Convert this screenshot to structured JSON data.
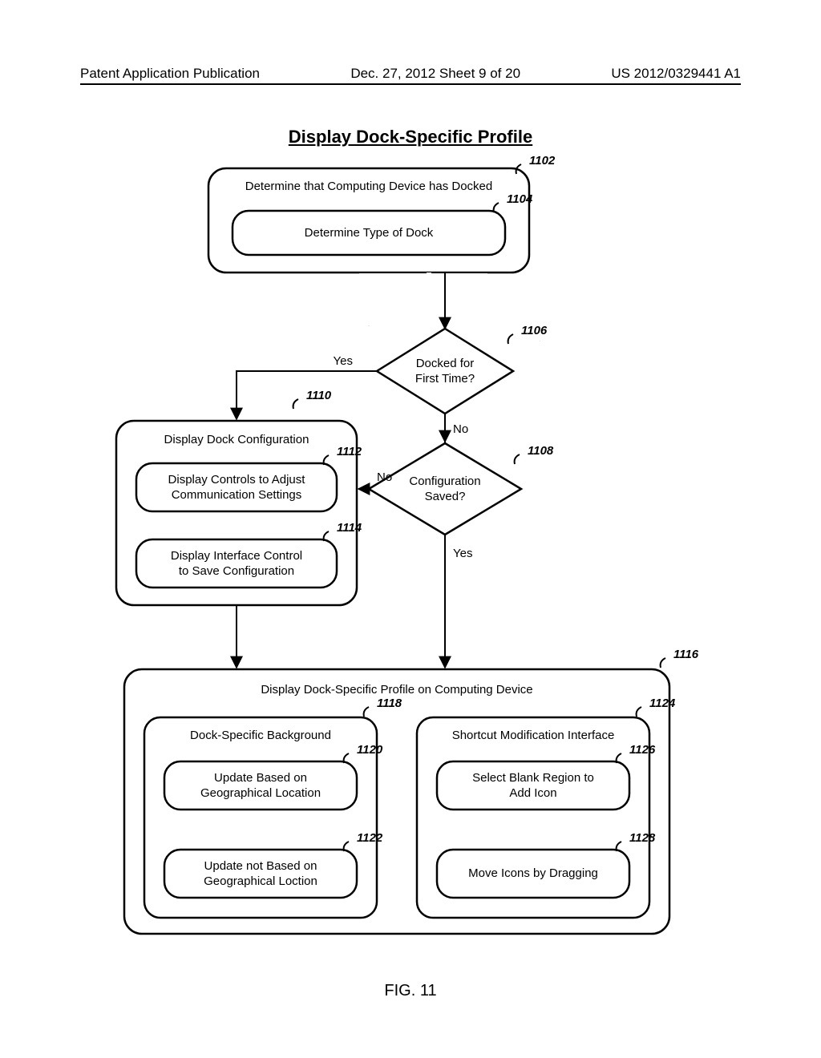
{
  "header": {
    "left": "Patent Application Publication",
    "center": "Dec. 27, 2012  Sheet 9 of 20",
    "right": "US 2012/0329441 A1"
  },
  "title": "Display Dock-Specific Profile",
  "figure_label": "FIG. 11",
  "refs": {
    "b1102": "1102",
    "b1104": "1104",
    "b1106": "1106",
    "b1108": "1108",
    "b1110": "1110",
    "b1112": "1112",
    "b1114": "1114",
    "b1116": "1116",
    "b1118": "1118",
    "b1120": "1120",
    "b1122": "1122",
    "b1124": "1124",
    "b1126": "1126",
    "b1128": "1128"
  },
  "boxes": {
    "b1102": "Determine that Computing Device has Docked",
    "b1104": "Determine Type of Dock",
    "b1106a": "Docked for",
    "b1106b": "First Time?",
    "b1108a": "Configuration",
    "b1108b": "Saved?",
    "b1110": "Display Dock Configuration",
    "b1112a": "Display Controls to Adjust",
    "b1112b": "Communication Settings",
    "b1114a": "Display Interface Control",
    "b1114b": "to Save Configuration",
    "b1116": "Display Dock-Specific Profile on Computing Device",
    "b1118": "Dock-Specific Background",
    "b1120a": "Update Based on",
    "b1120b": "Geographical Location",
    "b1122a": "Update not Based on",
    "b1122b": "Geographical Loction",
    "b1124": "Shortcut Modification Interface",
    "b1126a": "Select Blank Region to",
    "b1126b": "Add Icon",
    "b1128": "Move Icons by Dragging"
  },
  "edges": {
    "yes": "Yes",
    "no": "No"
  }
}
